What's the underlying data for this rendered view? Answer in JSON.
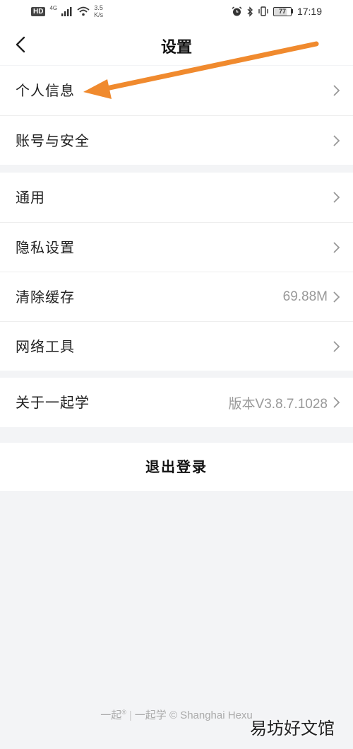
{
  "status_bar": {
    "hd": "HD",
    "signal": "4G",
    "speed_value": "3.5",
    "speed_unit": "K/s",
    "battery": "77",
    "time": "17:19",
    "battery_level": 0.77
  },
  "header": {
    "title": "设置"
  },
  "groups": [
    {
      "items": [
        {
          "label": "个人信息",
          "value": ""
        },
        {
          "label": "账号与安全",
          "value": ""
        }
      ]
    },
    {
      "items": [
        {
          "label": "通用",
          "value": ""
        },
        {
          "label": "隐私设置",
          "value": ""
        },
        {
          "label": "清除缓存",
          "value": "69.88M"
        },
        {
          "label": "网络工具",
          "value": ""
        }
      ]
    },
    {
      "items": [
        {
          "label": "关于一起学",
          "value": "版本V3.8.7.1028"
        }
      ]
    }
  ],
  "logout_label": "退出登录",
  "footer": {
    "brand1": "一起",
    "reg": "®",
    "separator": "|",
    "text": "一起学 © Shanghai Hexu"
  },
  "watermark": "易坊好文馆",
  "colors": {
    "annotation_arrow": "#f08a2e",
    "background": "#f3f4f6",
    "secondary_text": "#999999"
  },
  "icons": {
    "back": "chevron-left-icon",
    "row_arrow": "chevron-right-icon"
  }
}
